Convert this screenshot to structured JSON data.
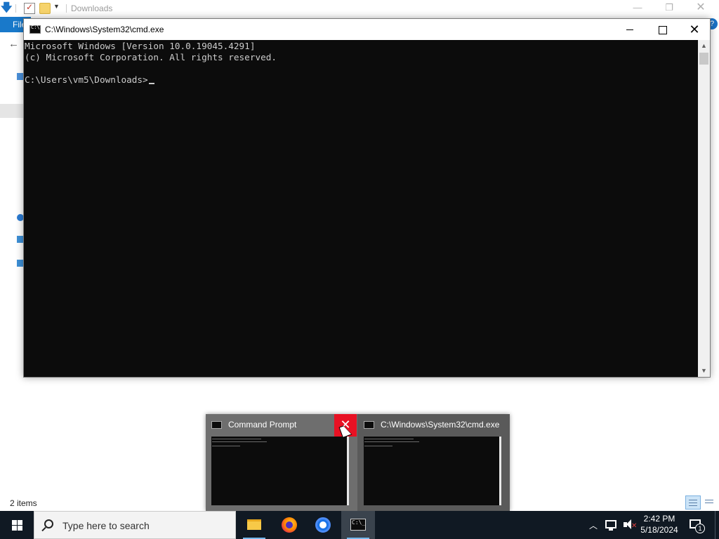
{
  "explorer": {
    "title": "Downloads",
    "file_tab": "File",
    "status": "2 items"
  },
  "cmd": {
    "title": "C:\\Windows\\System32\\cmd.exe",
    "lines": [
      "Microsoft Windows [Version 10.0.19045.4291]",
      "(c) Microsoft Corporation. All rights reserved.",
      "",
      "C:\\Users\\vm5\\Downloads>"
    ]
  },
  "preview": {
    "thumbs": [
      {
        "title": "Command Prompt"
      },
      {
        "title": "C:\\Windows\\System32\\cmd.exe"
      }
    ]
  },
  "taskbar": {
    "search_placeholder": "Type here to search",
    "clock": {
      "time": "2:42 PM",
      "date": "5/18/2024"
    },
    "notification_count": "1",
    "apps": [
      "file-explorer-icon",
      "firefox-icon",
      "chrome-icon",
      "cmd-icon"
    ]
  }
}
